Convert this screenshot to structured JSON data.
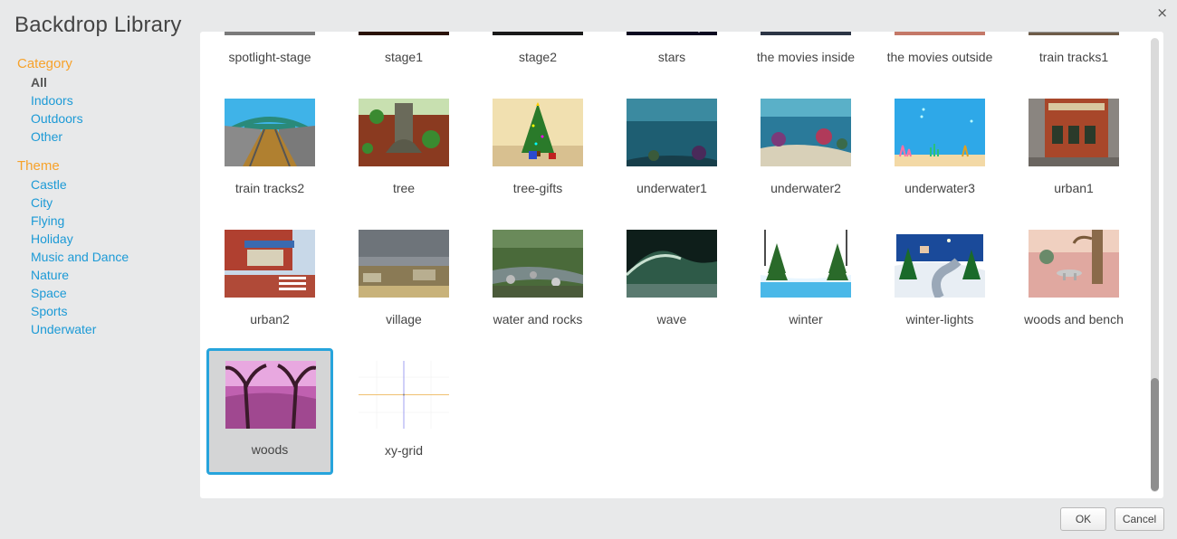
{
  "dialog": {
    "title": "Backdrop Library",
    "close_glyph": "×"
  },
  "sidebar": {
    "category_title": "Category",
    "categories": [
      {
        "label": "All",
        "active": true
      },
      {
        "label": "Indoors"
      },
      {
        "label": "Outdoors"
      },
      {
        "label": "Other"
      }
    ],
    "theme_title": "Theme",
    "themes": [
      {
        "label": "Castle"
      },
      {
        "label": "City"
      },
      {
        "label": "Flying"
      },
      {
        "label": "Holiday"
      },
      {
        "label": "Music and Dance"
      },
      {
        "label": "Nature"
      },
      {
        "label": "Space"
      },
      {
        "label": "Sports"
      },
      {
        "label": "Underwater"
      }
    ]
  },
  "library": {
    "items": [
      {
        "label": "spotlight-stage",
        "thumb": "spotlight-stage"
      },
      {
        "label": "stage1",
        "thumb": "stage1"
      },
      {
        "label": "stage2",
        "thumb": "stage2"
      },
      {
        "label": "stars",
        "thumb": "stars"
      },
      {
        "label": "the movies inside",
        "thumb": "movies-inside"
      },
      {
        "label": "the movies outside",
        "thumb": "movies-outside"
      },
      {
        "label": "train tracks1",
        "thumb": "train-tracks1"
      },
      {
        "label": "train tracks2",
        "thumb": "train-tracks2"
      },
      {
        "label": "tree",
        "thumb": "tree"
      },
      {
        "label": "tree-gifts",
        "thumb": "tree-gifts"
      },
      {
        "label": "underwater1",
        "thumb": "underwater1"
      },
      {
        "label": "underwater2",
        "thumb": "underwater2"
      },
      {
        "label": "underwater3",
        "thumb": "underwater3"
      },
      {
        "label": "urban1",
        "thumb": "urban1"
      },
      {
        "label": "urban2",
        "thumb": "urban2"
      },
      {
        "label": "village",
        "thumb": "village"
      },
      {
        "label": "water and rocks",
        "thumb": "water-rocks"
      },
      {
        "label": "wave",
        "thumb": "wave"
      },
      {
        "label": "winter",
        "thumb": "winter"
      },
      {
        "label": "winter-lights",
        "thumb": "winter-lights"
      },
      {
        "label": "woods and bench",
        "thumb": "woods-bench"
      },
      {
        "label": "woods",
        "thumb": "woods",
        "selected": true
      },
      {
        "label": "xy-grid",
        "thumb": "xy-grid"
      }
    ]
  },
  "footer": {
    "ok_label": "OK",
    "cancel_label": "Cancel"
  },
  "colors": {
    "accent": "#27a4dc",
    "section_title": "#f7a22a",
    "link": "#1c9ad6"
  }
}
